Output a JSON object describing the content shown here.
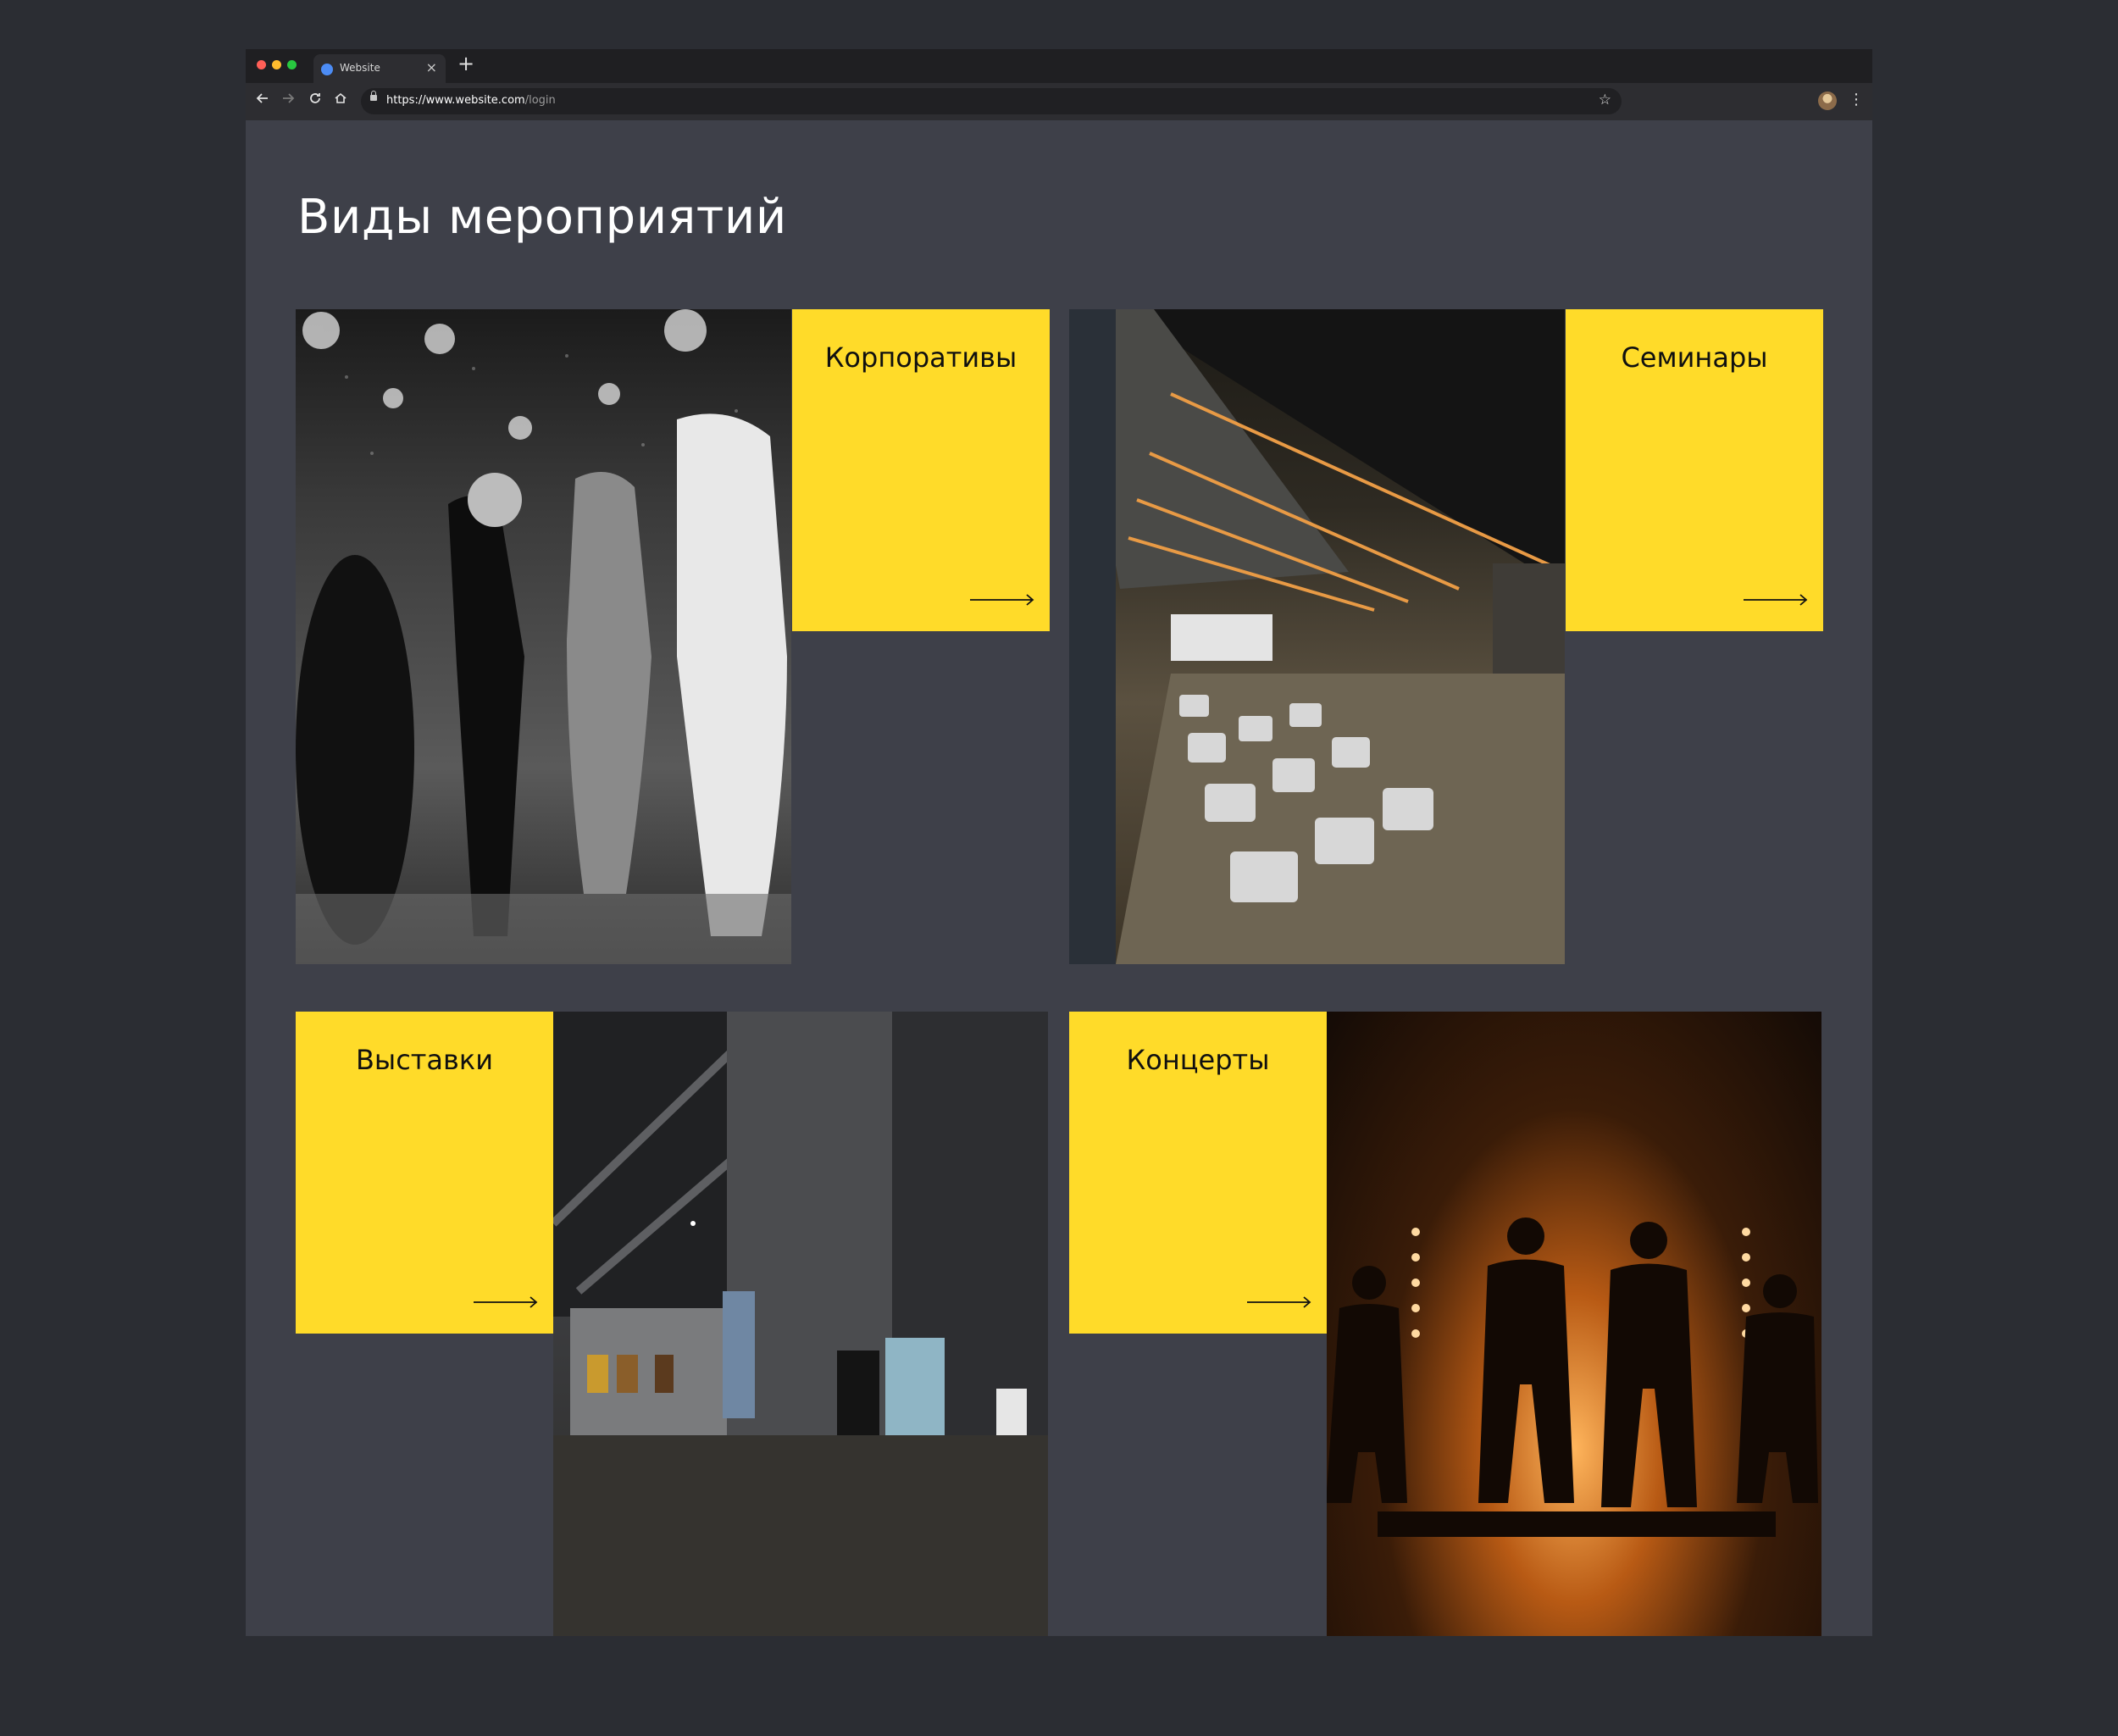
{
  "browser": {
    "tab_title": "Website",
    "tab_close": "×",
    "new_tab": "+",
    "url_host": "https://www.website.com",
    "url_path": "/login",
    "traffic_lights": [
      "#ff5f57",
      "#febc2e",
      "#28c840"
    ]
  },
  "page": {
    "title": "Виды мероприятий"
  },
  "events": [
    {
      "label": "Корпоративы",
      "arrow": "arrow-right-icon"
    },
    {
      "label": "Семинары",
      "arrow": "arrow-right-icon"
    },
    {
      "label": "Выставки",
      "arrow": "arrow-right-icon"
    },
    {
      "label": "Концерты",
      "arrow": "arrow-right-icon"
    }
  ],
  "colors": {
    "card_yellow": "#ffdb29",
    "page_background": "#3e4049",
    "outer_background": "#2b2d33"
  }
}
